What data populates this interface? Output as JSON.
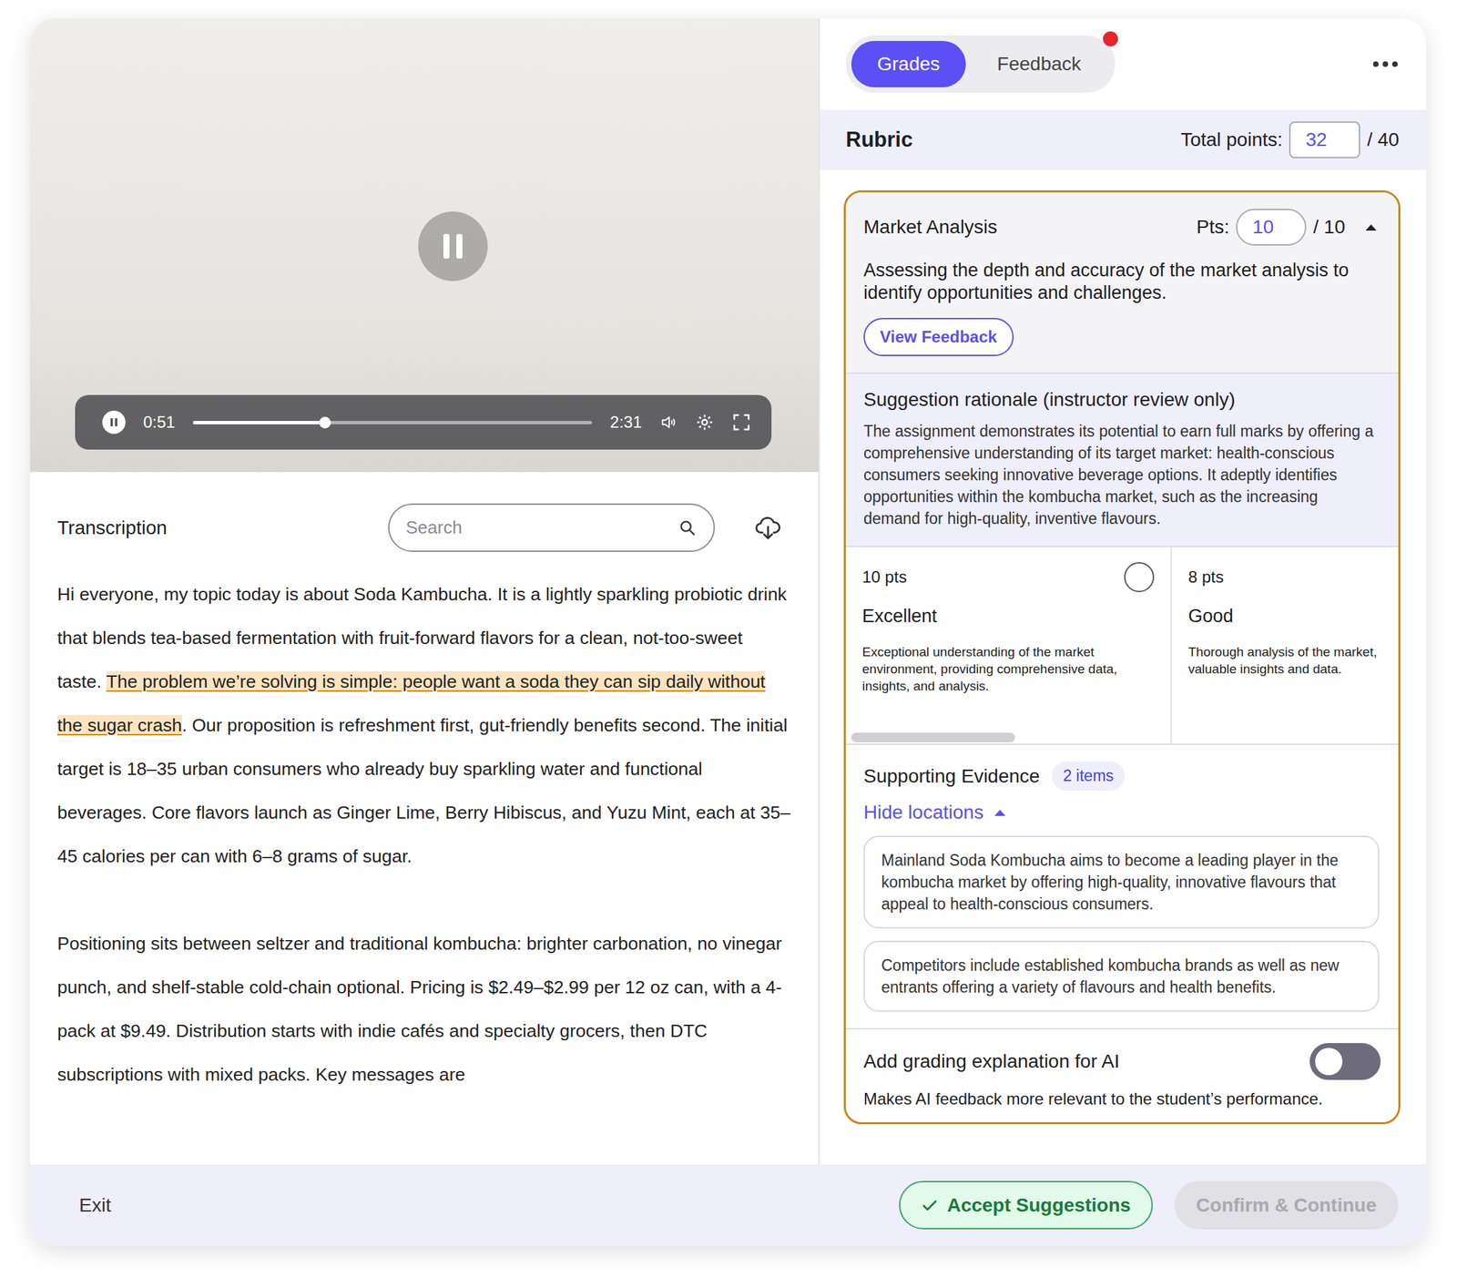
{
  "video": {
    "current": "0:51",
    "duration": "2:31",
    "level": 0.33,
    "playing": true
  },
  "transcription": {
    "title": "Transcription",
    "search": {
      "placeholder": "Search"
    },
    "paragraphs": [
      [
        {
          "text": "Hi everyone, my topic today is about Soda Kambucha. It is a lightly sparkling probiotic drink that blends tea-based fermentation with fruit-forward flavors for a clean, not-too-sweet taste. ",
          "highlighted": false
        },
        {
          "text": "The problem we’re solving is simple: people want a soda they can sip daily without the sugar crash",
          "highlighted": true
        },
        {
          "text": ". Our proposition is refreshment first, gut-friendly benefits second. The initial target is 18–35 urban consumers who already buy sparkling water and functional beverages. Core flavors launch as Ginger Lime, Berry Hibiscus, and Yuzu Mint, each at 35–45 calories per can with 6–8 grams of sugar.",
          "highlighted": false
        }
      ],
      [
        {
          "text": "Positioning sits between seltzer and traditional kombucha: brighter carbonation, no vinegar punch, and shelf-stable cold-chain optional. Pricing is $2.49–$2.99 per 12 oz can, with a 4-pack at $9.49. Distribution starts with indie cafés and specialty grocers, then DTC subscriptions with mixed packs. Key messages are",
          "highlighted": false
        }
      ]
    ]
  },
  "tabs": [
    {
      "label": "Grades",
      "selected": true,
      "badge": false
    },
    {
      "label": "Feedback",
      "selected": false,
      "badge": true
    }
  ],
  "rubric": {
    "title": "Rubric",
    "total_label": "Total points:",
    "total": "32",
    "max": "/ 40"
  },
  "criterion": {
    "title": "Market Analysis",
    "pts_label": "Pts:",
    "pts": "10",
    "max": "/ 10",
    "expanded": true,
    "description": "Assessing the depth and accuracy of the market analysis to identify opportunities and challenges.",
    "view_feedback": "View Feedback",
    "rationale": {
      "title": "Suggestion rationale (instructor review only)",
      "text": "The assignment demonstrates its potential to earn full marks by offering a comprehensive understanding of its target market: health-conscious consumers seeking innovative beverage options. It adeptly identifies opportunities within the kombucha market, such as the increasing demand for high-quality, inventive flavours."
    },
    "levels": [
      {
        "points": "10 pts",
        "label": "Excellent",
        "description": "Exceptional understanding of the market environment, providing comprehensive data, insights, and analysis.",
        "selected": false
      },
      {
        "points": "8 pts",
        "label": "Good",
        "description": "Thorough analysis of the market, valuable insights and data.",
        "selected": false
      }
    ],
    "evidence": {
      "title": "Supporting Evidence",
      "count": "2 items",
      "toggle_label": "Hide locations",
      "expanded": true,
      "items": [
        "Mainland Soda Kombucha aims to become a leading player in the kombucha market by offering high-quality, innovative flavours that appeal to health-conscious consumers.",
        "Competitors include established kombucha brands as well as new entrants offering a variety of flavours and health benefits."
      ]
    },
    "ai_explanation": {
      "label": "Add grading explanation for AI",
      "on": false,
      "hint": "Makes AI feedback more relevant to the student’s performance."
    }
  },
  "footer": {
    "exit": "Exit",
    "accept": "Accept Suggestions",
    "confirm": {
      "label": "Confirm & Continue",
      "disabled": true
    }
  }
}
